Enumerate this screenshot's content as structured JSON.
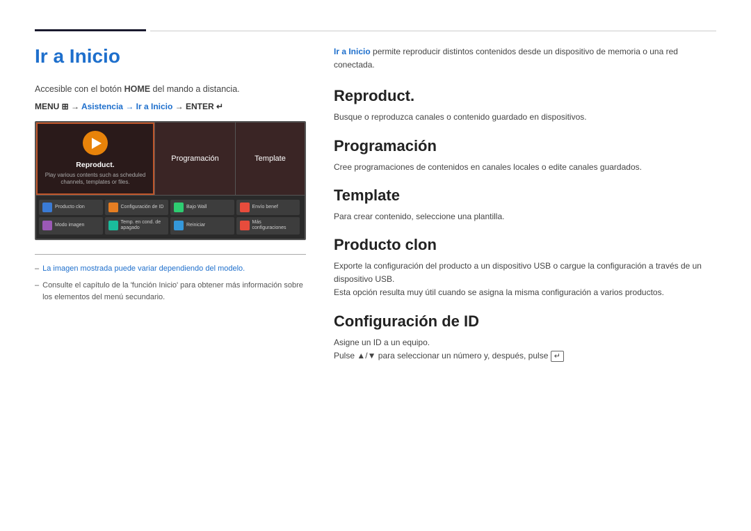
{
  "topbar": {
    "progress_active_label": "active-progress",
    "progress_inactive_label": "inactive-progress"
  },
  "left": {
    "title": "Ir a Inicio",
    "access_text_1": "Accesible con el botón ",
    "access_text_home": "HOME",
    "access_text_2": " del mando a distancia.",
    "menu_path": "MENU ",
    "menu_path_middle": "→ Asistencia → Ir a Inicio → ENTER",
    "tv": {
      "play_label": "Reproduct.",
      "play_sublabel": "Play various contents such as scheduled channels, templates or files.",
      "middle_label": "Programación",
      "right_label": "Template",
      "icons": [
        {
          "label": "Producto clon",
          "color": "#3a7bd5"
        },
        {
          "label": "Configuración de ID",
          "color": "#e67e22"
        },
        {
          "label": "Bajo Wall",
          "color": "#2ecc71"
        },
        {
          "label": "Envío benef",
          "color": "#e74c3c"
        },
        {
          "label": "Modo imagen",
          "color": "#9b59b6"
        },
        {
          "label": "Temp. en cond. de apagado",
          "color": "#1abc9c"
        },
        {
          "label": "Reiniciar",
          "color": "#3498db"
        },
        {
          "label": "Más configuraciones",
          "color": "#e74c3c"
        }
      ]
    },
    "notes": [
      {
        "dash": "–",
        "text_blue": "La imagen mostrada puede variar dependiendo del modelo.",
        "text": ""
      },
      {
        "dash": "–",
        "text_blue": "",
        "text": "Consulte el capítulo de la 'función Inicio' para obtener más información sobre los elementos del menú secundario."
      }
    ]
  },
  "right": {
    "intro": {
      "bold": "Ir a Inicio",
      "rest": " permite reproducir distintos contenidos desde un dispositivo de memoria o una red conectada."
    },
    "sections": [
      {
        "title": "Reproduct.",
        "desc": "Busque o reproduzca canales o contenido guardado en dispositivos."
      },
      {
        "title": "Programación",
        "desc": "Cree programaciones de contenidos en canales locales o edite canales guardados."
      },
      {
        "title": "Template",
        "desc": "Para crear contenido, seleccione una plantilla."
      },
      {
        "title": "Producto clon",
        "desc_line1": "Exporte la configuración del producto a un dispositivo USB o cargue la configuración a través de un dispositivo USB.",
        "desc_line2": "Esta opción resulta muy útil cuando se asigna la misma configuración a varios productos."
      },
      {
        "title": "Configuración de ID",
        "desc_line1": "Asigne un ID a un equipo.",
        "desc_line2": "Pulse ▲/▼ para seleccionar un número y, después, pulse"
      }
    ]
  }
}
